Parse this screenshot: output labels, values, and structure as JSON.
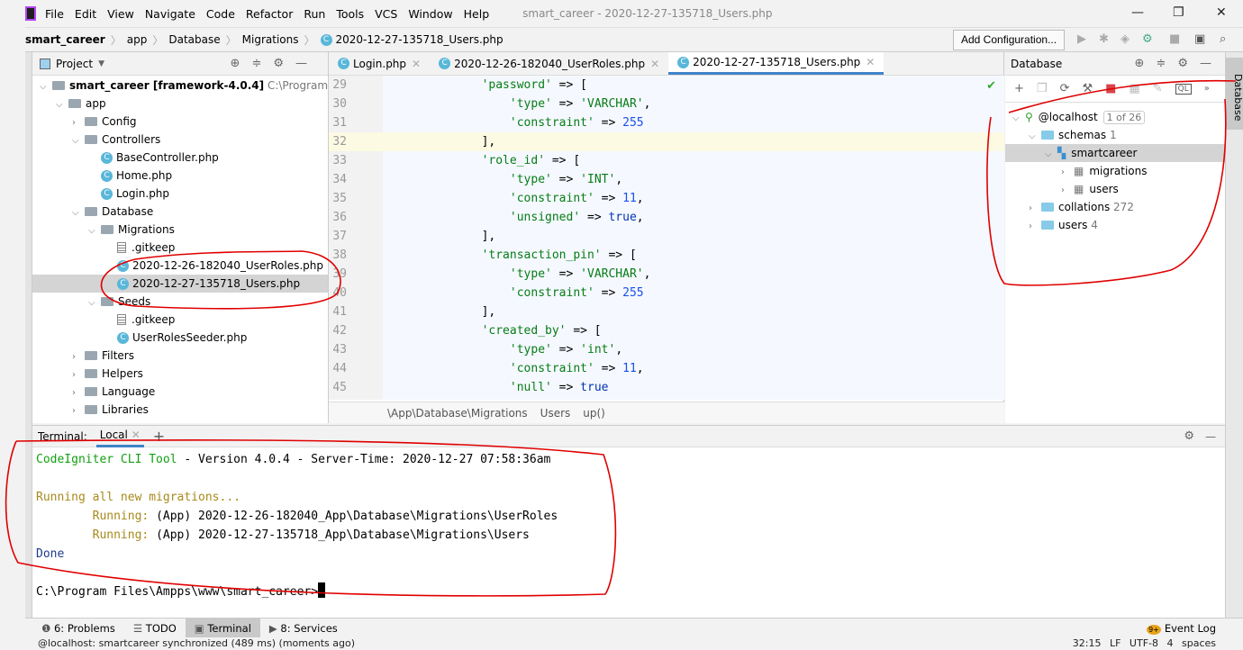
{
  "menu": {
    "items": [
      "File",
      "Edit",
      "View",
      "Navigate",
      "Code",
      "Refactor",
      "Run",
      "Tools",
      "VCS",
      "Window",
      "Help"
    ],
    "window_title": "smart_career - 2020-12-27-135718_Users.php"
  },
  "breadcrumb": {
    "items": [
      "smart_career",
      "app",
      "Database",
      "Migrations",
      "2020-12-27-135718_Users.php"
    ]
  },
  "toolbar": {
    "add_configuration": "Add Configuration..."
  },
  "project": {
    "title": "Project",
    "tree": [
      {
        "label": "smart_career [framework-4.0.4]",
        "extra": "C:\\Program Files\\Ampps",
        "level": 0,
        "type": "folder",
        "open": true,
        "bold": true
      },
      {
        "label": "app",
        "level": 1,
        "type": "folder",
        "open": true
      },
      {
        "label": "Config",
        "level": 2,
        "type": "folder",
        "open": false
      },
      {
        "label": "Controllers",
        "level": 2,
        "type": "folder",
        "open": true
      },
      {
        "label": "BaseController.php",
        "level": 3,
        "type": "php"
      },
      {
        "label": "Home.php",
        "level": 3,
        "type": "php"
      },
      {
        "label": "Login.php",
        "level": 3,
        "type": "php"
      },
      {
        "label": "Database",
        "level": 2,
        "type": "folder",
        "open": true
      },
      {
        "label": "Migrations",
        "level": 3,
        "type": "folder",
        "open": true
      },
      {
        "label": ".gitkeep",
        "level": 4,
        "type": "file"
      },
      {
        "label": "2020-12-26-182040_UserRoles.php",
        "level": 4,
        "type": "php"
      },
      {
        "label": "2020-12-27-135718_Users.php",
        "level": 4,
        "type": "php",
        "selected": true
      },
      {
        "label": "Seeds",
        "level": 3,
        "type": "folder",
        "open": true
      },
      {
        "label": ".gitkeep",
        "level": 4,
        "type": "file"
      },
      {
        "label": "UserRolesSeeder.php",
        "level": 4,
        "type": "php"
      },
      {
        "label": "Filters",
        "level": 2,
        "type": "folder",
        "open": false
      },
      {
        "label": "Helpers",
        "level": 2,
        "type": "folder",
        "open": false
      },
      {
        "label": "Language",
        "level": 2,
        "type": "folder",
        "open": false
      },
      {
        "label": "Libraries",
        "level": 2,
        "type": "folder",
        "open": false
      }
    ]
  },
  "editor": {
    "tabs": [
      {
        "label": "Login.php"
      },
      {
        "label": "2020-12-26-182040_UserRoles.php"
      },
      {
        "label": "2020-12-27-135718_Users.php",
        "active": true
      }
    ],
    "lines": [
      {
        "n": "29",
        "indent": 0,
        "parts": [
          [
            "s",
            "'password'"
          ],
          [
            "p",
            " => ["
          ]
        ]
      },
      {
        "n": "30",
        "indent": 1,
        "parts": [
          [
            "s",
            "'type'"
          ],
          [
            "p",
            " => "
          ],
          [
            "s",
            "'VARCHAR'"
          ],
          [
            "p",
            ","
          ]
        ]
      },
      {
        "n": "31",
        "indent": 1,
        "parts": [
          [
            "s",
            "'constraint'"
          ],
          [
            "p",
            " => "
          ],
          [
            "n",
            "255"
          ]
        ]
      },
      {
        "n": "32",
        "indent": 0,
        "parts": [
          [
            "p",
            "],"
          ]
        ],
        "current": true
      },
      {
        "n": "33",
        "indent": 0,
        "parts": [
          [
            "s",
            "'role_id'"
          ],
          [
            "p",
            " => ["
          ]
        ]
      },
      {
        "n": "34",
        "indent": 1,
        "parts": [
          [
            "s",
            "'type'"
          ],
          [
            "p",
            " => "
          ],
          [
            "s",
            "'INT'"
          ],
          [
            "p",
            ","
          ]
        ]
      },
      {
        "n": "35",
        "indent": 1,
        "parts": [
          [
            "s",
            "'constraint'"
          ],
          [
            "p",
            " => "
          ],
          [
            "n",
            "11"
          ],
          [
            "p",
            ","
          ]
        ]
      },
      {
        "n": "36",
        "indent": 1,
        "parts": [
          [
            "s",
            "'unsigned'"
          ],
          [
            "p",
            " => "
          ],
          [
            "k",
            "true"
          ],
          [
            "p",
            ","
          ]
        ]
      },
      {
        "n": "37",
        "indent": 0,
        "parts": [
          [
            "p",
            "],"
          ]
        ]
      },
      {
        "n": "38",
        "indent": 0,
        "parts": [
          [
            "s",
            "'transaction_pin'"
          ],
          [
            "p",
            " => ["
          ]
        ]
      },
      {
        "n": "39",
        "indent": 1,
        "parts": [
          [
            "s",
            "'type'"
          ],
          [
            "p",
            " => "
          ],
          [
            "s",
            "'VARCHAR'"
          ],
          [
            "p",
            ","
          ]
        ]
      },
      {
        "n": "40",
        "indent": 1,
        "parts": [
          [
            "s",
            "'constraint'"
          ],
          [
            "p",
            " => "
          ],
          [
            "n",
            "255"
          ]
        ]
      },
      {
        "n": "41",
        "indent": 0,
        "parts": [
          [
            "p",
            "],"
          ]
        ]
      },
      {
        "n": "42",
        "indent": 0,
        "parts": [
          [
            "s",
            "'created_by'"
          ],
          [
            "p",
            " => ["
          ]
        ]
      },
      {
        "n": "43",
        "indent": 1,
        "parts": [
          [
            "s",
            "'type'"
          ],
          [
            "p",
            " => "
          ],
          [
            "s",
            "'int'"
          ],
          [
            "p",
            ","
          ]
        ]
      },
      {
        "n": "44",
        "indent": 1,
        "parts": [
          [
            "s",
            "'constraint'"
          ],
          [
            "p",
            " => "
          ],
          [
            "n",
            "11"
          ],
          [
            "p",
            ","
          ]
        ]
      },
      {
        "n": "45",
        "indent": 1,
        "parts": [
          [
            "s",
            "'null'"
          ],
          [
            "p",
            " => "
          ],
          [
            "k",
            "true"
          ]
        ]
      }
    ],
    "breadcrumb": [
      "\\App\\Database\\Migrations",
      "Users",
      "up()"
    ]
  },
  "database": {
    "title": "Database",
    "stripe_label": "Database",
    "tree": [
      {
        "label": "@localhost",
        "badge": "1 of 26",
        "level": 0,
        "type": "host",
        "open": true
      },
      {
        "label": "schemas",
        "count": "1",
        "level": 1,
        "type": "folder",
        "open": true
      },
      {
        "label": "smartcareer",
        "level": 2,
        "type": "schema",
        "open": true,
        "selected": true
      },
      {
        "label": "migrations",
        "level": 3,
        "type": "table",
        "open": false
      },
      {
        "label": "users",
        "level": 3,
        "type": "table",
        "open": false
      },
      {
        "label": "collations",
        "count": "272",
        "level": 1,
        "type": "folder",
        "open": false
      },
      {
        "label": "users",
        "count": "4",
        "level": 1,
        "type": "folder",
        "open": false
      }
    ]
  },
  "terminal": {
    "label": "Terminal:",
    "tab": "Local",
    "lines": [
      {
        "text": "CodeIgniter CLI Tool - Version 4.0.4 - Server-Time: 2020-12-27 07:58:36am",
        "parts": [
          [
            "g",
            "CodeIgniter CLI Tool"
          ],
          [
            "p",
            " - Version 4.0.4 - Server-Time: 2020-12-27 07:58:36am"
          ]
        ]
      },
      {
        "parts": []
      },
      {
        "parts": [
          [
            "y",
            "Running all new migrations..."
          ]
        ]
      },
      {
        "parts": [
          [
            "y",
            "        Running: "
          ],
          [
            "p",
            "(App) 2020-12-26-182040_App\\Database\\Migrations\\UserRoles"
          ]
        ]
      },
      {
        "parts": [
          [
            "y",
            "        Running: "
          ],
          [
            "p",
            "(App) 2020-12-27-135718_App\\Database\\Migrations\\Users"
          ]
        ]
      },
      {
        "parts": [
          [
            "b",
            "Done"
          ]
        ]
      },
      {
        "parts": []
      },
      {
        "parts": [
          [
            "p",
            "C:\\Program Files\\Ampps\\www\\smart_career>"
          ]
        ],
        "prompt": true
      }
    ]
  },
  "bottom_tabs": [
    {
      "label": "6: Problems"
    },
    {
      "label": "TODO"
    },
    {
      "label": "Terminal",
      "active": true
    },
    {
      "label": "8: Services"
    }
  ],
  "event_log": {
    "label": "Event Log",
    "badge": "9+"
  },
  "status": {
    "message": "@localhost: smartcareer synchronized (489 ms) (moments ago)",
    "position": "32:15",
    "line_sep": "LF",
    "encoding": "UTF-8",
    "indent": "4 spaces"
  },
  "colors": {
    "accent": "#4083c9",
    "annotation": "#e00000",
    "string": "#067d17",
    "number": "#1750eb"
  }
}
